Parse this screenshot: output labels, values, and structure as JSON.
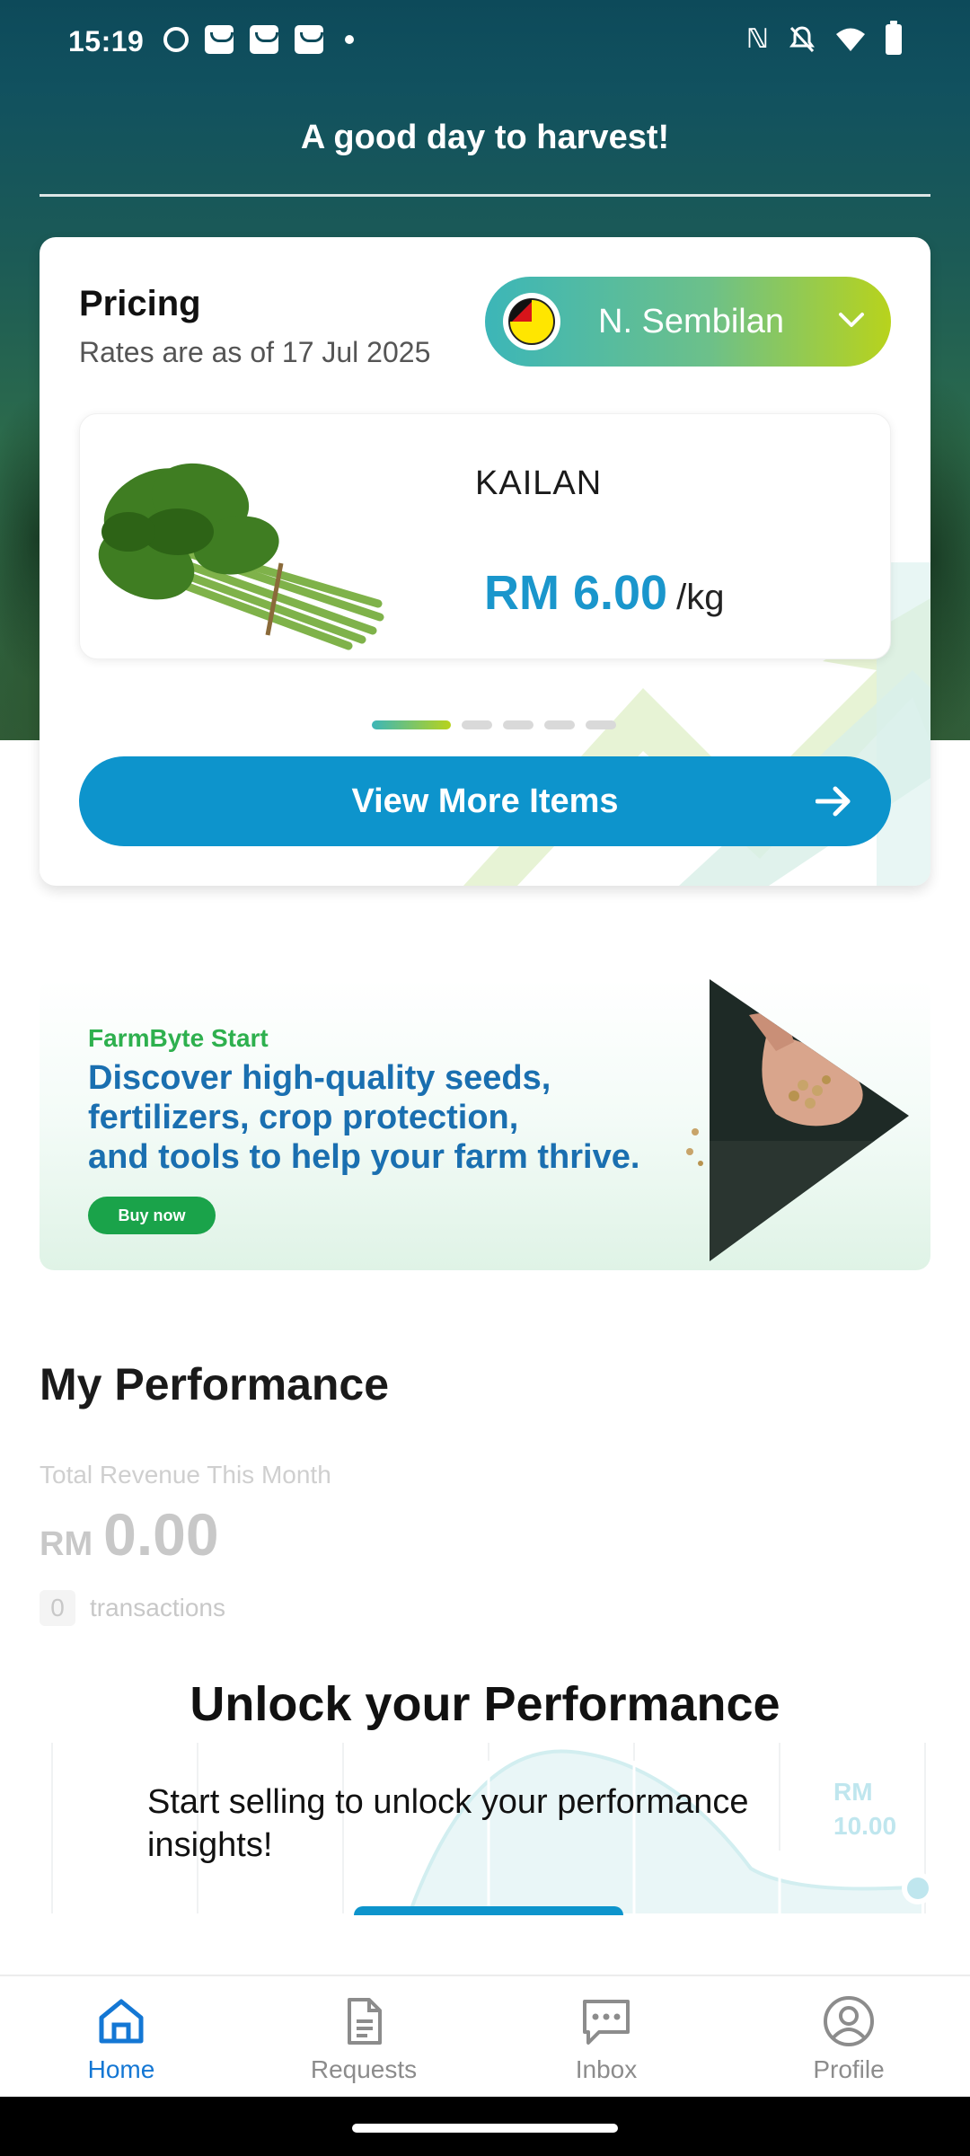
{
  "status_bar": {
    "time": "15:19"
  },
  "header": {
    "greeting": "A good day to harvest!"
  },
  "pricing": {
    "title": "Pricing",
    "subtitle": "Rates are as of 17 Jul 2025",
    "region": "N. Sembilan",
    "product": {
      "name": "KAILAN",
      "price": "RM 6.00",
      "unit": "/kg"
    },
    "carousel": {
      "total": 5,
      "active": 0
    },
    "view_more_label": "View More Items"
  },
  "banner": {
    "brand": "FarmByte Start",
    "headline_lines": [
      "Discover high-quality seeds,",
      "fertilizers, crop protection,",
      "and tools to help your farm thrive."
    ],
    "cta": "Buy now"
  },
  "performance": {
    "title": "My Performance",
    "revenue_label": "Total Revenue This Month",
    "currency": "RM",
    "revenue": "0.00",
    "transactions_count": "0",
    "transactions_label": "transactions",
    "unlock_title": "Unlock your Performance",
    "unlock_text": "Start selling to unlock your performance insights!",
    "chart_label_currency": "RM",
    "chart_label_value": "10.00"
  },
  "bottom_nav": [
    {
      "label": "Home",
      "icon": "home-icon",
      "active": true
    },
    {
      "label": "Requests",
      "icon": "document-icon",
      "active": false
    },
    {
      "label": "Inbox",
      "icon": "chat-icon",
      "active": false
    },
    {
      "label": "Profile",
      "icon": "user-circle-icon",
      "active": false
    }
  ],
  "colors": {
    "primary": "#0d94cc",
    "accent_green": "#b8d31c",
    "teal": "#3cb6b8",
    "nav_active": "#1477d4"
  }
}
